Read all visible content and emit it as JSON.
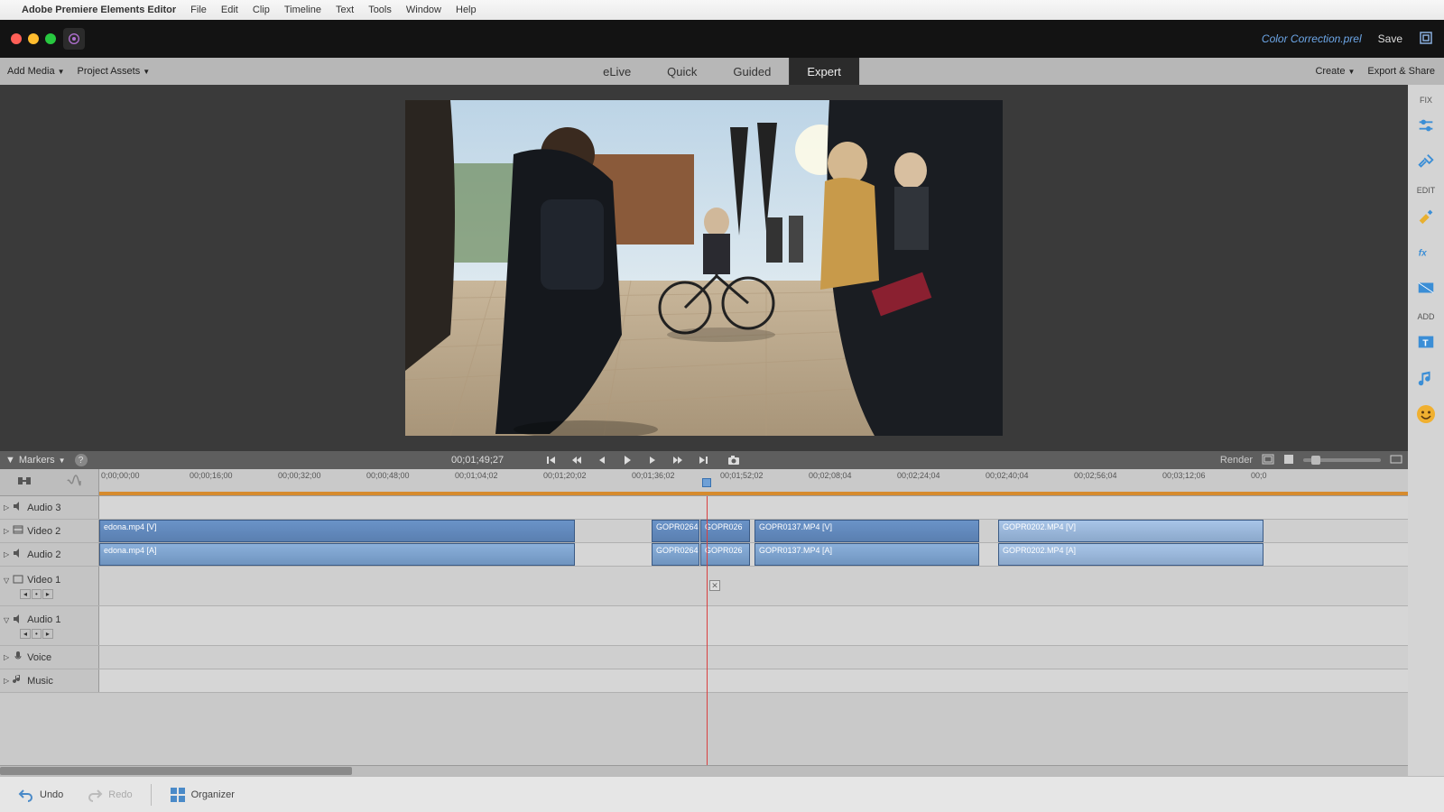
{
  "mac_menu": {
    "app": "Adobe Premiere Elements Editor",
    "items": [
      "File",
      "Edit",
      "Clip",
      "Timeline",
      "Text",
      "Tools",
      "Window",
      "Help"
    ]
  },
  "window": {
    "project_name": "Color Correction.prel",
    "save": "Save"
  },
  "toolbar": {
    "add_media": "Add Media",
    "project_assets": "Project Assets",
    "tabs": {
      "elive": "eLive",
      "quick": "Quick",
      "guided": "Guided",
      "expert": "Expert"
    },
    "create": "Create",
    "export": "Export & Share"
  },
  "right_panel": {
    "fix": "FIX",
    "edit": "EDIT",
    "add": "ADD"
  },
  "timeline_header": {
    "markers": "Markers",
    "current_tc": "00;01;49;27",
    "render": "Render"
  },
  "ruler_ticks": [
    "0;00;00;00",
    "00;00;16;00",
    "00;00;32;00",
    "00;00;48;00",
    "00;01;04;02",
    "00;01;20;02",
    "00;01;36;02",
    "00;01;52;02",
    "00;02;08;04",
    "00;02;24;04",
    "00;02;40;04",
    "00;02;56;04",
    "00;03;12;06",
    "00;0"
  ],
  "tracks": {
    "audio3": "Audio 3",
    "video2": "Video 2",
    "audio2": "Audio 2",
    "video1": "Video 1",
    "audio1": "Audio 1",
    "voice": "Voice",
    "music": "Music"
  },
  "clips": {
    "sedona_v": "edona.mp4 [V]",
    "sedona_a": "edona.mp4 [A]",
    "g264_v": "GOPR0264.",
    "g264_a": "GOPR0264.",
    "g026_v": "GOPR026",
    "g026_a": "GOPR026",
    "g137_v": "GOPR0137.MP4 [V]",
    "g137_a": "GOPR0137.MP4 [A]",
    "g202_v": "GOPR0202.MP4 [V]",
    "g202_a": "GOPR0202.MP4 [A]"
  },
  "bottom": {
    "undo": "Undo",
    "redo": "Redo",
    "organizer": "Organizer"
  },
  "colors": {
    "accent": "#6fa0d6",
    "orange": "#d68b2e",
    "playhead": "#d94040"
  }
}
